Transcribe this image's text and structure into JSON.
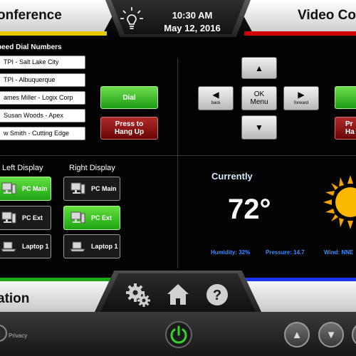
{
  "header": {
    "left_title": "onference",
    "right_title": "Video Conf",
    "time": "10:30 AM",
    "date": "May 12, 2016",
    "center_icon": "lightbulb-icon"
  },
  "speed_dial": {
    "title": "peed Dial Numbers",
    "items": [
      "TPI - Salt Lake City",
      "TPI - Albuquerque",
      "ames Miller - Logix Corp",
      "Susan Woods - Apex",
      "w Smith - Cutting Edge"
    ],
    "dial_label": "Dial",
    "hangup_label": "Press to Hang Up"
  },
  "camera_nav": {
    "up_icon": "arrow-up-icon",
    "down_icon": "arrow-down-icon",
    "back_label": "back",
    "forward_label": "forward",
    "ok_label": "OK",
    "menu_label": "Menu",
    "right_red_label": "Pr Ha"
  },
  "displays": {
    "left_title": "Left Display",
    "right_title": "Right Display",
    "sources": [
      "PC Main",
      "PC Ext",
      "Laptop 1"
    ],
    "left_active": "PC Main",
    "right_active": "PC Ext"
  },
  "weather": {
    "label": "Currently",
    "temperature": "72°",
    "humidity": "Humidity: 32%",
    "pressure": "Pressure: 14.7",
    "wind": "Wind: NNE",
    "icon": "sun-icon"
  },
  "footer": {
    "title": "ation",
    "icons": [
      "gears-icon",
      "home-icon",
      "help-icon"
    ],
    "privacy_label": "Privacy",
    "power_icon": "power-icon"
  },
  "colors": {
    "accent_yellow": "#e8c800",
    "accent_red": "#d00000",
    "accent_green": "#18a818",
    "accent_blue": "#1b35ff",
    "button_green": "#2fb51f",
    "button_red": "#8b1010"
  }
}
